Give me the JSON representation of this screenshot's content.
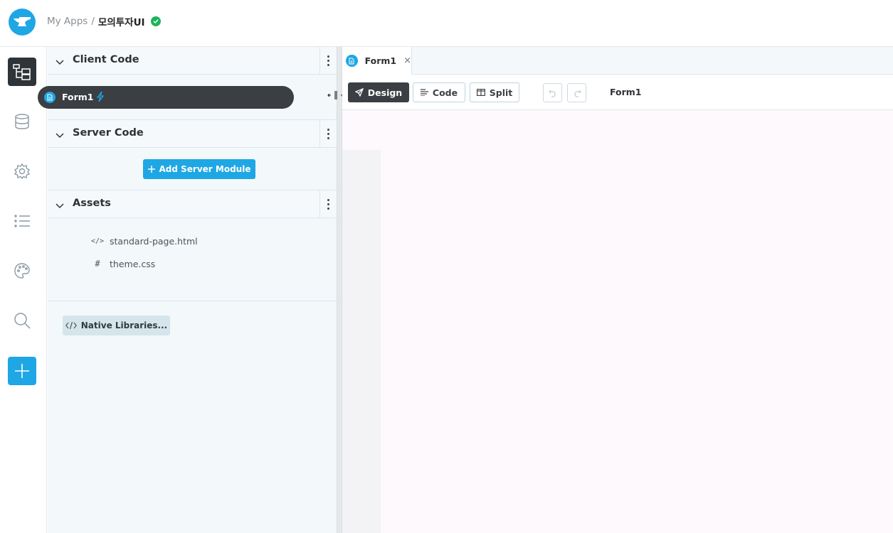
{
  "breadcrumb": {
    "root": "My Apps",
    "separator": "/",
    "app_name": "모의투자UI"
  },
  "sections": {
    "client_code": {
      "title": "Client Code",
      "forms": [
        {
          "label": "Form1"
        }
      ]
    },
    "server_code": {
      "title": "Server Code",
      "add_button": "Add Server Module"
    },
    "assets": {
      "title": "Assets",
      "items": [
        {
          "icon": "</>",
          "label": "standard-page.html"
        },
        {
          "icon": "#",
          "label": "theme.css"
        }
      ]
    },
    "native_libraries": "Native Libraries..."
  },
  "editor": {
    "tab": {
      "label": "Form1",
      "close": "×"
    },
    "toolbar": {
      "design": "Design",
      "code": "Code",
      "split": "Split",
      "form_name": "Form1"
    }
  },
  "colors": {
    "accent": "#1ea7e4",
    "dark": "#3b3f43",
    "status_ok": "#20b45a"
  }
}
